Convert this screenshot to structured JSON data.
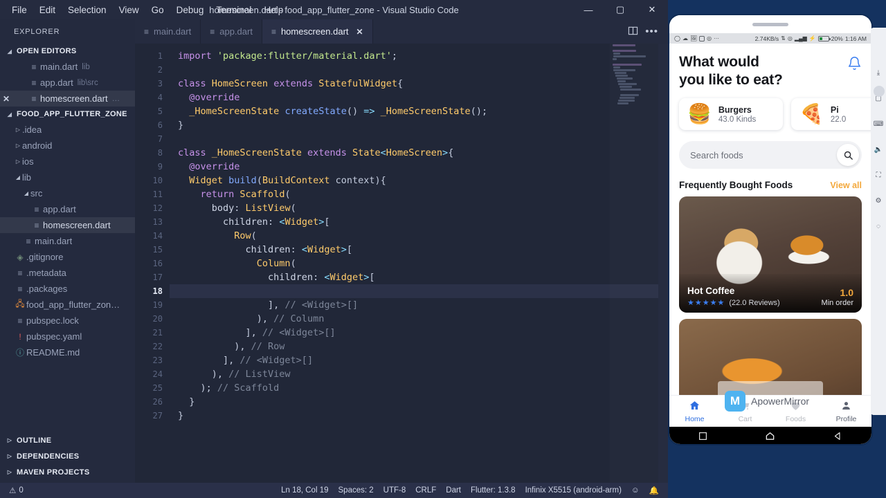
{
  "window": {
    "title": "homescreen.dart - food_app_flutter_zone - Visual Studio Code",
    "minimize": "—",
    "maximize": "▢",
    "close": "✕"
  },
  "menubar": [
    "File",
    "Edit",
    "Selection",
    "View",
    "Go",
    "Debug",
    "Terminal",
    "Help"
  ],
  "sidebar": {
    "header": "EXPLORER",
    "open_editors": {
      "title": "OPEN EDITORS",
      "items": [
        {
          "name": "main.dart",
          "path": "lib",
          "icon": "dart-file-icon",
          "closable": false,
          "active": false
        },
        {
          "name": "app.dart",
          "path": "lib\\src",
          "icon": "dart-file-icon",
          "closable": false,
          "active": false
        },
        {
          "name": "homescreen.dart",
          "path": "…",
          "icon": "dart-file-icon",
          "closable": true,
          "active": true
        }
      ]
    },
    "project": {
      "title": "FOOD_APP_FLUTTER_ZONE",
      "items": [
        {
          "label": ".idea",
          "type": "folder",
          "expanded": false,
          "indent": 1,
          "icon": "folder-icon"
        },
        {
          "label": "android",
          "type": "folder",
          "expanded": false,
          "indent": 1,
          "icon": "folder-icon"
        },
        {
          "label": "ios",
          "type": "folder",
          "expanded": false,
          "indent": 1,
          "icon": "folder-icon"
        },
        {
          "label": "lib",
          "type": "folder",
          "expanded": true,
          "indent": 1,
          "icon": "folder-icon"
        },
        {
          "label": "src",
          "type": "folder",
          "expanded": true,
          "indent": 2,
          "icon": "folder-icon"
        },
        {
          "label": "app.dart",
          "type": "file",
          "indent": 3,
          "icon": "dart-file-icon"
        },
        {
          "label": "homescreen.dart",
          "type": "file",
          "indent": 3,
          "icon": "dart-file-icon",
          "active": true
        },
        {
          "label": "main.dart",
          "type": "file",
          "indent": 2,
          "icon": "dart-file-icon"
        },
        {
          "label": ".gitignore",
          "type": "file",
          "indent": 1,
          "icon": "git-icon"
        },
        {
          "label": ".metadata",
          "type": "file",
          "indent": 1,
          "icon": "dart-file-icon"
        },
        {
          "label": ".packages",
          "type": "file",
          "indent": 1,
          "icon": "dart-file-icon"
        },
        {
          "label": "food_app_flutter_zon…",
          "type": "file",
          "indent": 1,
          "icon": "feed-icon"
        },
        {
          "label": "pubspec.lock",
          "type": "file",
          "indent": 1,
          "icon": "dart-file-icon"
        },
        {
          "label": "pubspec.yaml",
          "type": "file",
          "indent": 1,
          "icon": "yaml-icon"
        },
        {
          "label": "README.md",
          "type": "file",
          "indent": 1,
          "icon": "info-icon"
        }
      ]
    },
    "bottom_sections": [
      "OUTLINE",
      "DEPENDENCIES",
      "MAVEN PROJECTS"
    ]
  },
  "tabs": [
    {
      "label": "main.dart",
      "active": false,
      "closable": false
    },
    {
      "label": "app.dart",
      "active": false,
      "closable": false
    },
    {
      "label": "homescreen.dart",
      "active": true,
      "closable": true
    }
  ],
  "editor": {
    "first_line": 1,
    "current_line": 18,
    "lines": [
      [
        [
          "import ",
          "kw"
        ],
        [
          "'package:flutter/material.dart'",
          "str"
        ],
        [
          ";",
          "plain"
        ]
      ],
      [],
      [
        [
          "class ",
          "kw"
        ],
        [
          "HomeScreen",
          "type"
        ],
        [
          " extends ",
          "kw"
        ],
        [
          "StatefulWidget",
          "type"
        ],
        [
          "{",
          "plain"
        ]
      ],
      [
        [
          "  ",
          "plain"
        ],
        [
          "@override",
          "kw"
        ]
      ],
      [
        [
          "  ",
          "plain"
        ],
        [
          "_HomeScreenState",
          "type"
        ],
        [
          " ",
          "plain"
        ],
        [
          "createState",
          "fn"
        ],
        [
          "()",
          "plain"
        ],
        [
          " => ",
          "punc"
        ],
        [
          "_HomeScreenState",
          "type"
        ],
        [
          "();",
          "plain"
        ]
      ],
      [
        [
          "}",
          "plain"
        ]
      ],
      [],
      [
        [
          "class ",
          "kw"
        ],
        [
          "_HomeScreenState",
          "type"
        ],
        [
          " extends ",
          "kw"
        ],
        [
          "State",
          "type"
        ],
        [
          "<",
          "punc"
        ],
        [
          "HomeScreen",
          "type"
        ],
        [
          ">",
          "punc"
        ],
        [
          "{",
          "plain"
        ]
      ],
      [
        [
          "  ",
          "plain"
        ],
        [
          "@override",
          "kw"
        ]
      ],
      [
        [
          "  ",
          "plain"
        ],
        [
          "Widget ",
          "type"
        ],
        [
          "build",
          "fn"
        ],
        [
          "(",
          "plain"
        ],
        [
          "BuildContext",
          "type"
        ],
        [
          " context){",
          "plain"
        ]
      ],
      [
        [
          "    ",
          "plain"
        ],
        [
          "return ",
          "kw"
        ],
        [
          "Scaffold",
          "type"
        ],
        [
          "(",
          "plain"
        ]
      ],
      [
        [
          "      body",
          "var"
        ],
        [
          ": ",
          "plain"
        ],
        [
          "ListView",
          "type"
        ],
        [
          "(",
          "plain"
        ]
      ],
      [
        [
          "        children",
          "var"
        ],
        [
          ": ",
          "plain"
        ],
        [
          "<",
          "punc"
        ],
        [
          "Widget",
          "type"
        ],
        [
          ">",
          "punc"
        ],
        [
          "[",
          "plain"
        ]
      ],
      [
        [
          "          ",
          "plain"
        ],
        [
          "Row",
          "type"
        ],
        [
          "(",
          "plain"
        ]
      ],
      [
        [
          "            children",
          "var"
        ],
        [
          ": ",
          "plain"
        ],
        [
          "<",
          "punc"
        ],
        [
          "Widget",
          "type"
        ],
        [
          ">",
          "punc"
        ],
        [
          "[",
          "plain"
        ]
      ],
      [
        [
          "              ",
          "plain"
        ],
        [
          "Column",
          "type"
        ],
        [
          "(",
          "plain"
        ]
      ],
      [
        [
          "                children",
          "var"
        ],
        [
          ": ",
          "plain"
        ],
        [
          "<",
          "punc"
        ],
        [
          "Widget",
          "type"
        ],
        [
          ">",
          "punc"
        ],
        [
          "[",
          "plain"
        ]
      ],
      [],
      [
        [
          "                ], ",
          "plain"
        ],
        [
          "// <Widget>[]",
          "com"
        ]
      ],
      [
        [
          "              ), ",
          "plain"
        ],
        [
          "// Column",
          "com"
        ]
      ],
      [
        [
          "            ], ",
          "plain"
        ],
        [
          "// <Widget>[]",
          "com"
        ]
      ],
      [
        [
          "          ), ",
          "plain"
        ],
        [
          "// Row",
          "com"
        ]
      ],
      [
        [
          "        ], ",
          "plain"
        ],
        [
          "// <Widget>[]",
          "com"
        ]
      ],
      [
        [
          "      ), ",
          "plain"
        ],
        [
          "// ListView",
          "com"
        ]
      ],
      [
        [
          "    ); ",
          "plain"
        ],
        [
          "// Scaffold",
          "com"
        ]
      ],
      [
        [
          "  }",
          "plain"
        ]
      ],
      [
        [
          "}",
          "plain"
        ]
      ]
    ]
  },
  "statusbar": {
    "problems": "0",
    "right_items": [
      "Ln 18, Col 19",
      "Spaces: 2",
      "UTF-8",
      "CRLF",
      "Dart",
      "Flutter: 1.3.8",
      "Infinix X5515 (android-arm)"
    ],
    "feedback_icon": "smiley-icon",
    "bell_icon": "bell-icon"
  },
  "phone": {
    "status_bar": {
      "speed": "2.74KB/s",
      "battery": "20%",
      "time": "1:16 AM",
      "left_icons": [
        "message-icon",
        "cloud-icon",
        "photo-icon",
        "sim-icon",
        "whatsapp-icon",
        "more-icon"
      ]
    },
    "app": {
      "heading_line1": "What would",
      "heading_line2": "you like to eat?",
      "bell_icon": "notification-bell-icon",
      "categories": [
        {
          "emoji": "🍔",
          "name": "Burgers",
          "sub": "43.0 Kinds",
          "icon": "burger-icon"
        },
        {
          "emoji": "🍕",
          "name": "Pi",
          "sub": "22.0",
          "icon": "pizza-icon"
        }
      ],
      "search": {
        "placeholder": "Search foods",
        "value": "",
        "icon": "search-icon"
      },
      "section": {
        "title": "Frequently Bought Foods",
        "link": "View all"
      },
      "food_cards": [
        {
          "name": "Hot Coffee",
          "stars": "★★★★★",
          "reviews": "(22.0 Reviews)",
          "price": "1.0",
          "price_label": "Min order"
        }
      ],
      "bottom_nav": [
        {
          "label": "Home",
          "icon": "home-icon",
          "active": true
        },
        {
          "label": "Cart",
          "icon": "cart-icon",
          "active": false
        },
        {
          "label": "Foods",
          "icon": "heart-icon",
          "active": false
        },
        {
          "label": "Profile",
          "icon": "person-icon",
          "active": false
        }
      ],
      "system_nav": [
        "square-icon",
        "home-outline-icon",
        "back-triangle-icon"
      ],
      "gesture_bar": [
        "back-arrow-icon",
        "home-arc-icon",
        "menu-lines-icon"
      ]
    },
    "watermark": {
      "text": "ApowerMirror",
      "logo": "M"
    }
  },
  "colors": {
    "accent_orange": "#f3a83c",
    "accent_blue": "#2f6fe0",
    "vscode_bg": "#212738",
    "sidebar_bg": "#242a3e",
    "mirror_bg": "#14325f"
  }
}
